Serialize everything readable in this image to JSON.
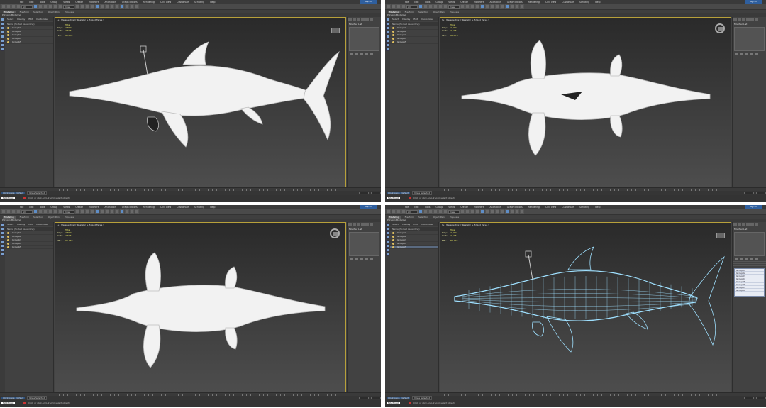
{
  "menu": [
    "File",
    "Edit",
    "Tools",
    "Group",
    "Views",
    "Create",
    "Modifiers",
    "Animation",
    "Graph Editors",
    "Rendering",
    "Civil View",
    "Customize",
    "Scripting",
    "Help"
  ],
  "help_button": "Sign In",
  "toolbar": {
    "selection_filter": "All",
    "view": "View"
  },
  "ribbon_tabs": [
    "Modeling",
    "Freeform",
    "Selection",
    "Object Paint",
    "Populate"
  ],
  "ribbon_active": "Modeling",
  "subribbon": "Polygon Modeling",
  "explorer_tabs": [
    "Select",
    "Display",
    "Edit",
    "Customize"
  ],
  "explorer_header": "Name (Sorted Ascending)",
  "panels": [
    {
      "viewport_label": "[+] [Perspective] [ Realistic + Edged Faces ]",
      "stats": {
        "head": "Total",
        "polys_label": "Polys:",
        "polys": "2,800",
        "verts_label": "Verts:",
        "verts": "2,676",
        "fps_label": "FPS:",
        "fps": "90.432"
      },
      "scene_objects": [
        "Groupb1",
        "Groupb2",
        "Groupb3",
        "Groupb4",
        "Groupb5"
      ],
      "right_title": "Modifier List",
      "workspace": "Workspace: Default",
      "status": "None Selected",
      "prompt": "Click or click-and-drag to select objects",
      "view": "side"
    },
    {
      "viewport_label": "[+] [Perspective] [ Realistic + Edged Faces ]",
      "stats": {
        "head": "Total",
        "polys_label": "Polys:",
        "polys": "2,800",
        "verts_label": "Verts:",
        "verts": "2,676",
        "fps_label": "FPS:",
        "fps": "80.476"
      },
      "scene_objects": [
        "Groupb1",
        "Groupb2",
        "Groupb3",
        "Groupb4",
        "Groupb5"
      ],
      "right_title": "Modifier List",
      "workspace": "Workspace: Default",
      "status": "None Selected",
      "prompt": "Click or click-and-drag to select objects",
      "view": "bottom"
    },
    {
      "viewport_label": "[+] [Perspective] [ Realistic + Edged Faces ]",
      "stats": {
        "head": "Total",
        "polys_label": "Polys:",
        "polys": "2,800",
        "verts_label": "Verts:",
        "verts": "2,676",
        "fps_label": "FPS:",
        "fps": "90.432"
      },
      "scene_objects": [
        "Groupb1",
        "Groupb2",
        "Groupb3",
        "Groupb4",
        "Groupb5"
      ],
      "right_title": "Modifier List",
      "workspace": "Workspace: Default",
      "status": "None Selected",
      "prompt": "Click or click-and-drag to select objects",
      "view": "top"
    },
    {
      "viewport_label": "[+] [Perspective] [ Realistic + Edged Faces ]",
      "stats": {
        "head": "Total",
        "polys_label": "Polys:",
        "polys": "2,800",
        "verts_label": "Verts:",
        "verts": "2,676",
        "fps_label": "FPS:",
        "fps": "80.476"
      },
      "scene_objects": [
        "Groupb1",
        "Groupb2",
        "Groupb3",
        "Groupb4",
        "Groupb5"
      ],
      "right_title": "Modifier List",
      "workspace": "Workspace: Default",
      "status": "None Selected",
      "prompt": "Click or click-and-drag to select objects",
      "view": "wire"
    }
  ],
  "right_list_items": [
    "Group01",
    "Group02",
    "Group03",
    "Group04",
    "Group05",
    "Group06",
    "Group07",
    "Group08"
  ],
  "colors": {
    "viewport_border": "#b7a03a",
    "stats_text": "#e0e060",
    "wire": "#9fe0ff",
    "fish": "#f2f2f2",
    "workspace_bg": "#2d4f7a"
  }
}
